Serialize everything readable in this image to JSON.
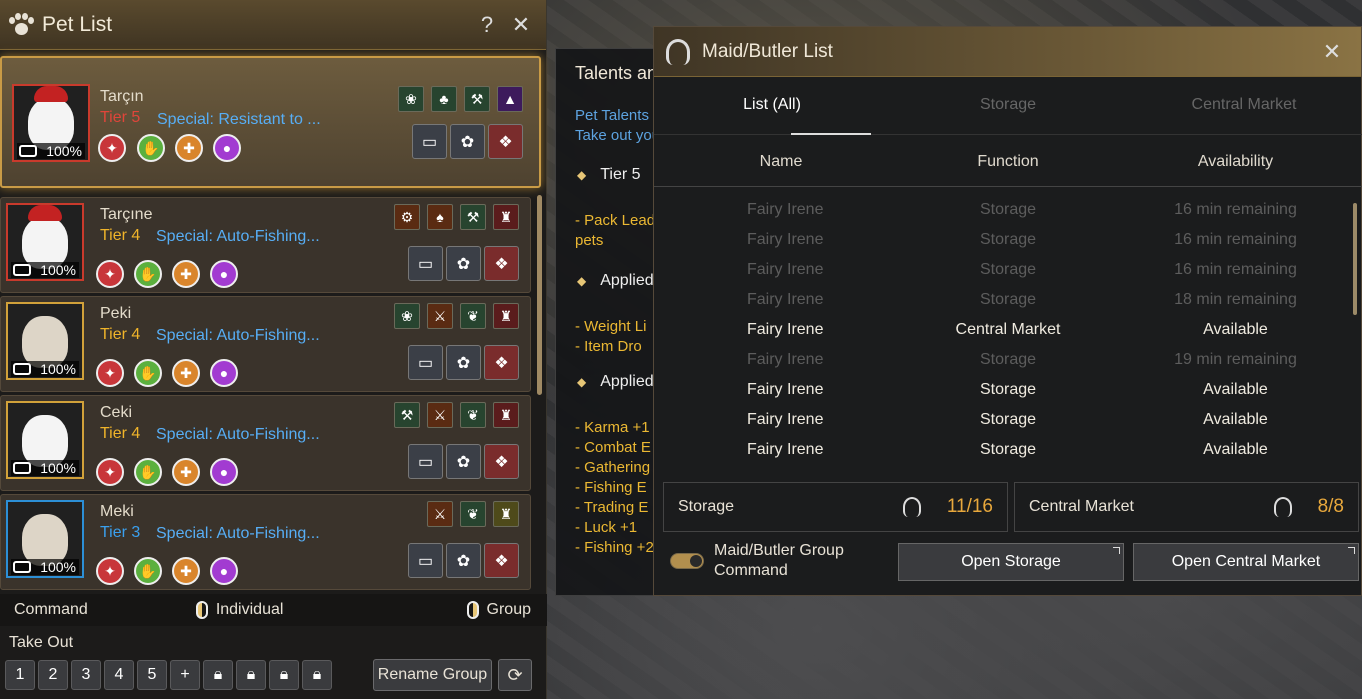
{
  "pet_list": {
    "title": "Pet List",
    "help": "?",
    "close": "✕",
    "pets": [
      {
        "name": "Tarçın",
        "tier_label": "Tier 5",
        "tier_color": "#e0453a",
        "special": "Special: Resistant to ...",
        "food": "100%"
      },
      {
        "name": "Tarçıne",
        "tier_label": "Tier 4",
        "tier_color": "#f0b42a",
        "special": "Special: Auto-Fishing...",
        "food": "100%"
      },
      {
        "name": "Peki",
        "tier_label": "Tier 4",
        "tier_color": "#f0b42a",
        "special": "Special: Auto-Fishing...",
        "food": "100%"
      },
      {
        "name": "Ceki",
        "tier_label": "Tier 4",
        "tier_color": "#f0b42a",
        "special": "Special: Auto-Fishing...",
        "food": "100%"
      },
      {
        "name": "Meki",
        "tier_label": "Tier 3",
        "tier_color": "#3aa0ee",
        "special": "Special: Auto-Fishing...",
        "food": "100%"
      }
    ],
    "command": "Command",
    "individual": "Individual",
    "group": "Group",
    "take_out": "Take Out",
    "slots": [
      "1",
      "2",
      "3",
      "4",
      "5"
    ],
    "add": "+",
    "rename_group": "Rename Group"
  },
  "talents": {
    "title": "Talents an",
    "desc1": "Pet Talents",
    "desc2": "Take out you",
    "sec1": "Tier 5",
    "pack_leader1": "- Pack Leade",
    "pack_leader2": "pets",
    "sec2": "Applied",
    "applied_talents": [
      "- Weight Li",
      "- Item Dro"
    ],
    "sec3": "Applied",
    "applied_skills": [
      "- Karma +1",
      "- Combat E",
      "- Gathering",
      "- Fishing E",
      "- Trading E",
      "- Luck +1",
      "- Fishing +2"
    ]
  },
  "maid": {
    "title": "Maid/Butler List",
    "close": "✕",
    "tabs": [
      "List (All)",
      "Storage",
      "Central Market"
    ],
    "columns": [
      "Name",
      "Function",
      "Availability"
    ],
    "rows": [
      {
        "name": "Fairy Irene",
        "function": "Storage",
        "availability": "16 min remaining"
      },
      {
        "name": "Fairy Irene",
        "function": "Storage",
        "availability": "16 min remaining"
      },
      {
        "name": "Fairy Irene",
        "function": "Storage",
        "availability": "16 min remaining"
      },
      {
        "name": "Fairy Irene",
        "function": "Storage",
        "availability": "18 min remaining"
      },
      {
        "name": "Fairy Irene",
        "function": "Central Market",
        "availability": "Available"
      },
      {
        "name": "Fairy Irene",
        "function": "Storage",
        "availability": "19 min remaining"
      },
      {
        "name": "Fairy Irene",
        "function": "Storage",
        "availability": "Available"
      },
      {
        "name": "Fairy Irene",
        "function": "Storage",
        "availability": "Available"
      },
      {
        "name": "Fairy Irene",
        "function": "Storage",
        "availability": "Available"
      }
    ],
    "storage_label": "Storage",
    "storage_count": "11/16",
    "market_label": "Central Market",
    "market_count": "8/8",
    "group_command_line1": "Maid/Butler Group",
    "group_command_line2": "Command",
    "open_storage": "Open Storage",
    "open_market": "Open Central Market"
  }
}
